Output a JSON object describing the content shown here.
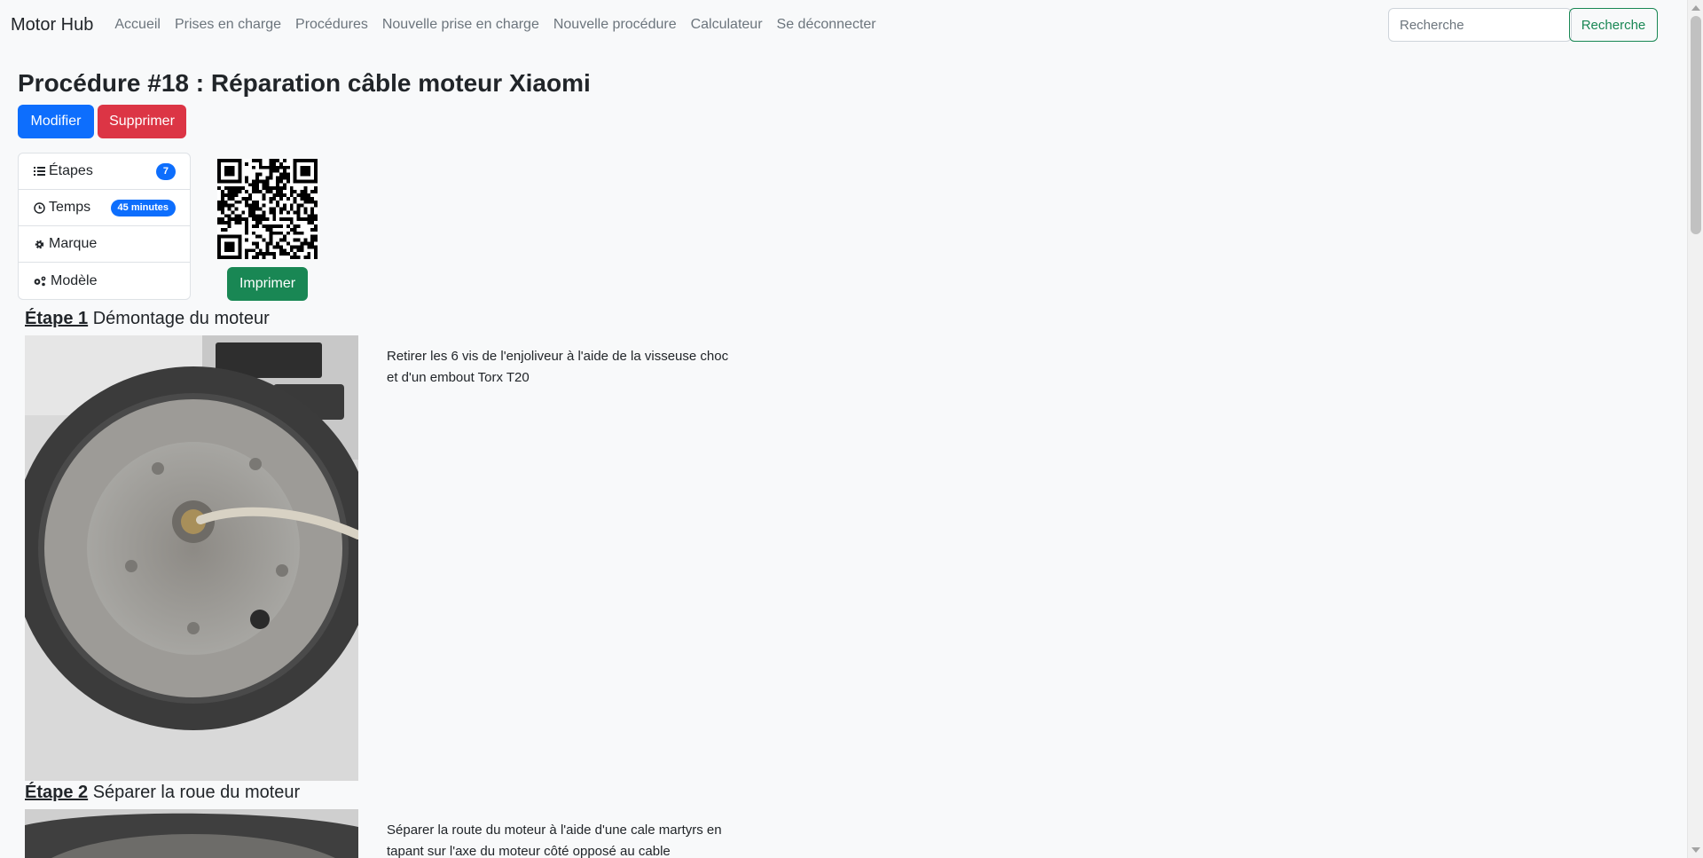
{
  "navbar": {
    "brand": "Motor Hub",
    "links": [
      "Accueil",
      "Prises en charge",
      "Procédures",
      "Nouvelle prise en charge",
      "Nouvelle procédure",
      "Calculateur",
      "Se déconnecter"
    ],
    "search_placeholder": "Recherche",
    "search_button": "Recherche"
  },
  "procedure": {
    "title": "Procédure #18 : Réparation câble moteur Xiaomi",
    "edit_label": "Modifier",
    "delete_label": "Supprimer",
    "print_label": "Imprimer",
    "info": [
      {
        "icon": "list-icon",
        "label": "Étapes",
        "badge": "7"
      },
      {
        "icon": "clock-icon",
        "label": "Temps",
        "badge": "45 minutes"
      },
      {
        "icon": "gear-icon",
        "label": "Marque",
        "badge": ""
      },
      {
        "icon": "gears-icon",
        "label": "Modèle",
        "badge": ""
      }
    ]
  },
  "steps": [
    {
      "number": "Étape 1",
      "title": "Démontage du moteur",
      "text": "Retirer les 6 vis de l'enjoliveur à l'aide de la visseuse choc et d'un embout Torx T20"
    },
    {
      "number": "Étape 2",
      "title": "Séparer la roue du moteur",
      "text": "Séparer la route du moteur à l'aide d'une cale martyrs en tapant sur l'axe du moteur côté opposé au cable"
    }
  ],
  "colors": {
    "primary": "#0d6efd",
    "danger": "#dc3545",
    "success": "#198754",
    "background": "#f8f9fa"
  }
}
